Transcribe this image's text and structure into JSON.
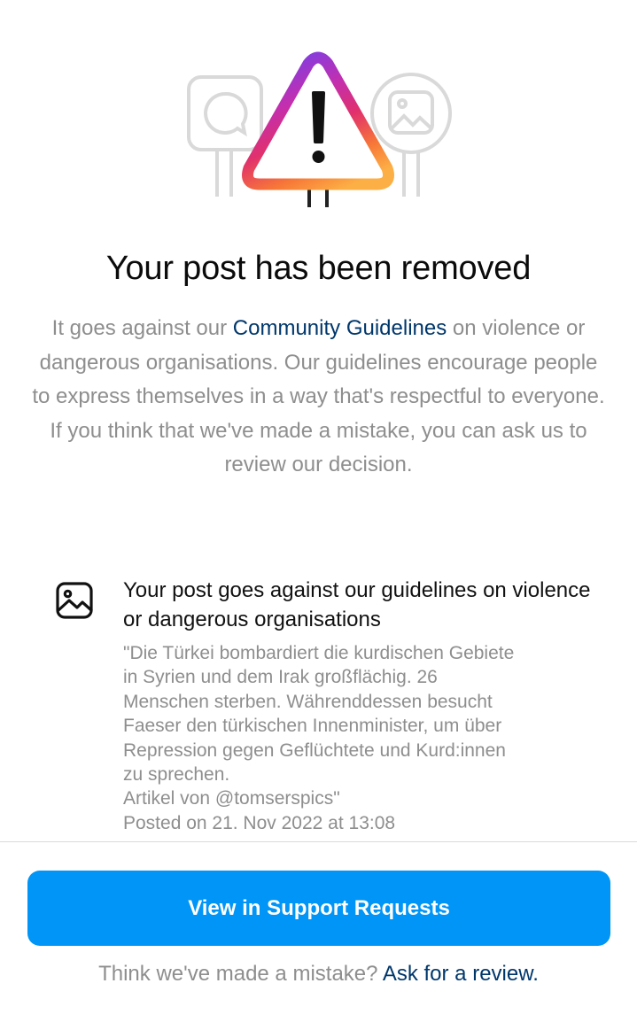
{
  "header": {
    "title": "Your post has been removed"
  },
  "intro": {
    "before_link": "It goes against our ",
    "link_label": "Community Guidelines",
    "after_link": " on violence or dangerous organisations. Our guidelines encourage people to express themselves in a way that's respectful to everyone. If you think that we've made a mistake, you can ask us to review our decision."
  },
  "reason": {
    "icon": "image-icon",
    "heading": "Your post goes against our guidelines on violence or dangerous organisations",
    "quote_lines": [
      "\"Die Türkei bombardiert die kurdischen Gebiete",
      "in Syrien und dem Irak großflächig. 26",
      "Menschen sterben. Währenddessen besucht",
      "Faeser den türkischen Innenminister, um über",
      "Repression gegen Geflüchtete und Kurd:innen",
      "zu sprechen.",
      "Artikel von @tomserspics\"",
      "Posted on 21. Nov 2022 at 13:08"
    ]
  },
  "actions": {
    "primary_label": "View in Support Requests",
    "footer_prefix": "Think we've made a mistake? ",
    "footer_link": "Ask for a review."
  },
  "colors": {
    "primary": "#0095f6",
    "link": "#00376b",
    "secondary_text": "#8e8e8e",
    "warning_gradient": [
      "#7b3fe4",
      "#d62976",
      "#fa7e1e",
      "#feda75"
    ]
  }
}
